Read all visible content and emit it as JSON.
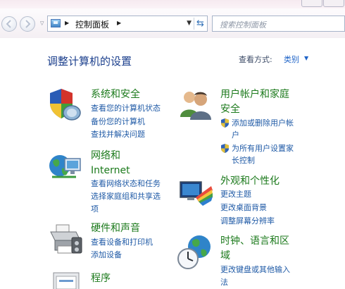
{
  "navigation": {
    "breadcrumb": [
      "控制面板"
    ],
    "search_placeholder": "搜索控制面板"
  },
  "header": {
    "title": "调整计算机的设置",
    "view_by_label": "查看方式:",
    "view_by_value": "类别"
  },
  "categories": {
    "system_security": {
      "title": "系统和安全",
      "links": [
        "查看您的计算机状态",
        "备份您的计算机",
        "查找并解决问题"
      ]
    },
    "network": {
      "title_line1": "网络和",
      "title_line2": "Internet",
      "links": [
        "查看网络状态和任务",
        "选择家庭组和共享选",
        "项"
      ]
    },
    "hardware": {
      "title": "硬件和声音",
      "links": [
        "查看设备和打印机",
        "添加设备"
      ]
    },
    "programs": {
      "title": "程序"
    },
    "user_accounts": {
      "title_line1": "用户帐户和家庭",
      "title_line2": "安全",
      "links": [
        "添加或删除用户帐",
        "户",
        "为所有用户设置家",
        "长控制"
      ]
    },
    "appearance": {
      "title": "外观和个性化",
      "links": [
        "更改主题",
        "更改桌面背景",
        "调整屏幕分辨率"
      ]
    },
    "clock": {
      "title_line1": "时钟、语言和区",
      "title_line2": "域",
      "links": [
        "更改键盘或其他输入",
        "法"
      ]
    }
  },
  "icons": {
    "back": "back-arrow-icon",
    "forward": "forward-arrow-icon",
    "control_panel": "control-panel-icon",
    "refresh": "refresh-icon",
    "system_security": "security-shield-icon",
    "network": "network-globe-icon",
    "hardware": "printer-icon",
    "programs": "programs-icon",
    "user_accounts": "users-icon",
    "appearance": "display-palette-icon",
    "clock": "clock-globe-icon",
    "admin_shield": "uac-shield-icon"
  },
  "colors": {
    "category_title": "#1c7a1c",
    "link": "#1f5aa6",
    "heading": "#1a3e8c"
  }
}
